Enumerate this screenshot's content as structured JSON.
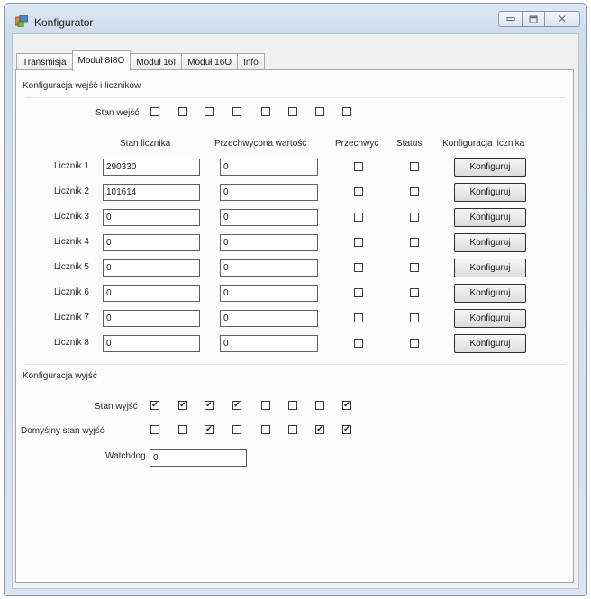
{
  "window": {
    "title": "Konfigurator",
    "close_glyph": "✕"
  },
  "tabs": [
    {
      "label": "Transmisja",
      "active": false
    },
    {
      "label": "Moduł 8I8O",
      "active": true
    },
    {
      "label": "Moduł 16I",
      "active": false
    },
    {
      "label": "Moduł 16O",
      "active": false
    },
    {
      "label": "Info",
      "active": false
    }
  ],
  "inputs_group": {
    "title": "Konfiguracja wejść i liczników",
    "stan_wejsc_label": "Stan wejść",
    "stan_wejsc": [
      false,
      false,
      false,
      false,
      false,
      false,
      false,
      false
    ]
  },
  "counters": {
    "headers": {
      "stan_licznika": "Stan licznika",
      "przechwycona": "Przechwycona wartość",
      "przechwyc": "Przechwyć",
      "status": "Status",
      "konfiguracja": "Konfiguracja licznika"
    },
    "rows": [
      {
        "label": "Licznik 1",
        "stan": "290330",
        "przechwycona": "0",
        "przechwyc": false,
        "status": false,
        "button": "Konfiguruj"
      },
      {
        "label": "Licznik 2",
        "stan": "101614",
        "przechwycona": "0",
        "przechwyc": false,
        "status": false,
        "button": "Konfiguruj"
      },
      {
        "label": "Licznik 3",
        "stan": "0",
        "przechwycona": "0",
        "przechwyc": false,
        "status": false,
        "button": "Konfiguruj"
      },
      {
        "label": "Licznik 4",
        "stan": "0",
        "przechwycona": "0",
        "przechwyc": false,
        "status": false,
        "button": "Konfiguruj"
      },
      {
        "label": "Licznik 5",
        "stan": "0",
        "przechwycona": "0",
        "przechwyc": false,
        "status": false,
        "button": "Konfiguruj"
      },
      {
        "label": "Licznik 6",
        "stan": "0",
        "przechwycona": "0",
        "przechwyc": false,
        "status": false,
        "button": "Konfiguruj"
      },
      {
        "label": "Licznik 7",
        "stan": "0",
        "przechwycona": "0",
        "przechwyc": false,
        "status": false,
        "button": "Konfiguruj"
      },
      {
        "label": "Licznik 8",
        "stan": "0",
        "przechwycona": "0",
        "przechwyc": false,
        "status": false,
        "button": "Konfiguruj"
      }
    ]
  },
  "outputs_group": {
    "title": "Konfiguracja wyjść",
    "stan_wyjsc_label": "Stan wyjść",
    "stan_wyjsc": [
      true,
      true,
      true,
      true,
      false,
      false,
      false,
      true
    ],
    "domyslny_label": "Domyślny stan wyjść",
    "domyslny": [
      false,
      false,
      true,
      false,
      false,
      false,
      true,
      true
    ],
    "watchdog_label": "Watchdog",
    "watchdog_value": "0"
  }
}
